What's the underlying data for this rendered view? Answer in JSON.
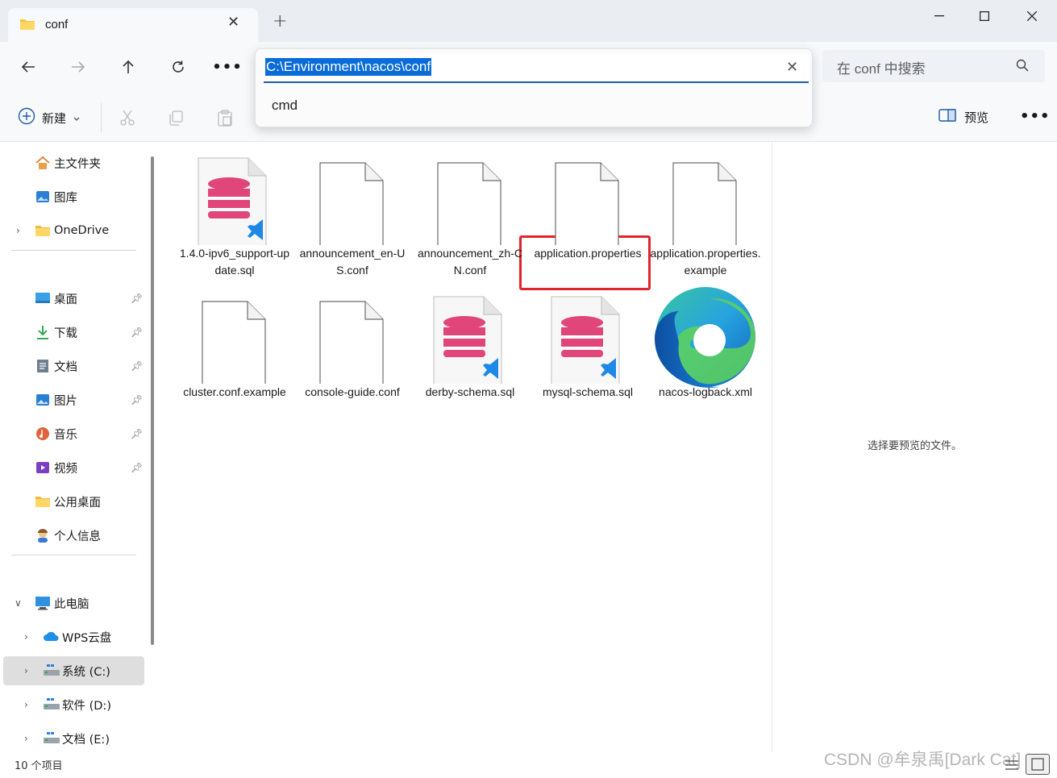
{
  "tab": {
    "title": "conf"
  },
  "address": {
    "path": "C:\\Environment\\nacos\\conf",
    "suggestion": "cmd"
  },
  "search": {
    "placeholder": "在 conf 中搜索"
  },
  "toolbar": {
    "new_label": "新建",
    "preview_label": "预览"
  },
  "sidebar": {
    "items": [
      {
        "label": "主文件夹",
        "icon": "home-icon"
      },
      {
        "label": "图库",
        "icon": "gallery-icon"
      },
      {
        "label": "OneDrive",
        "icon": "folder-icon"
      },
      {
        "label": "桌面",
        "icon": "desktop-icon",
        "pinned": true
      },
      {
        "label": "下载",
        "icon": "download-icon",
        "pinned": true
      },
      {
        "label": "文档",
        "icon": "document-icon",
        "pinned": true
      },
      {
        "label": "图片",
        "icon": "pictures-icon",
        "pinned": true
      },
      {
        "label": "音乐",
        "icon": "music-icon",
        "pinned": true
      },
      {
        "label": "视频",
        "icon": "video-icon",
        "pinned": true
      },
      {
        "label": "公用桌面",
        "icon": "folder-icon"
      },
      {
        "label": "个人信息",
        "icon": "person-icon"
      },
      {
        "label": "此电脑",
        "icon": "computer-icon"
      },
      {
        "label": "WPS云盘",
        "icon": "cloud-icon"
      },
      {
        "label": "系统 (C:)",
        "icon": "drive-icon",
        "selected": true
      },
      {
        "label": "软件 (D:)",
        "icon": "drive-icon"
      },
      {
        "label": "文档 (E:)",
        "icon": "drive-icon"
      }
    ]
  },
  "files": [
    {
      "name": "1.4.0-ipv6_support-update.sql",
      "type": "sql"
    },
    {
      "name": "announcement_en-US.conf",
      "type": "blank"
    },
    {
      "name": "announcement_zh-CN.conf",
      "type": "blank"
    },
    {
      "name": "application.properties",
      "type": "blank",
      "highlighted": true
    },
    {
      "name": "application.properties.example",
      "type": "blank"
    },
    {
      "name": "cluster.conf.example",
      "type": "blank"
    },
    {
      "name": "console-guide.conf",
      "type": "blank"
    },
    {
      "name": "derby-schema.sql",
      "type": "sql"
    },
    {
      "name": "mysql-schema.sql",
      "type": "sql"
    },
    {
      "name": "nacos-logback.xml",
      "type": "edge"
    }
  ],
  "preview": {
    "message": "选择要预览的文件。"
  },
  "status": {
    "count": "10 个项目"
  },
  "watermark": "CSDN @牟泉禹[Dark Cat]",
  "colors": {
    "accent": "#0a6cd8",
    "highlight_border": "#e3232c",
    "db_pink": "#e0467a",
    "vscode_blue": "#1e88e5"
  }
}
